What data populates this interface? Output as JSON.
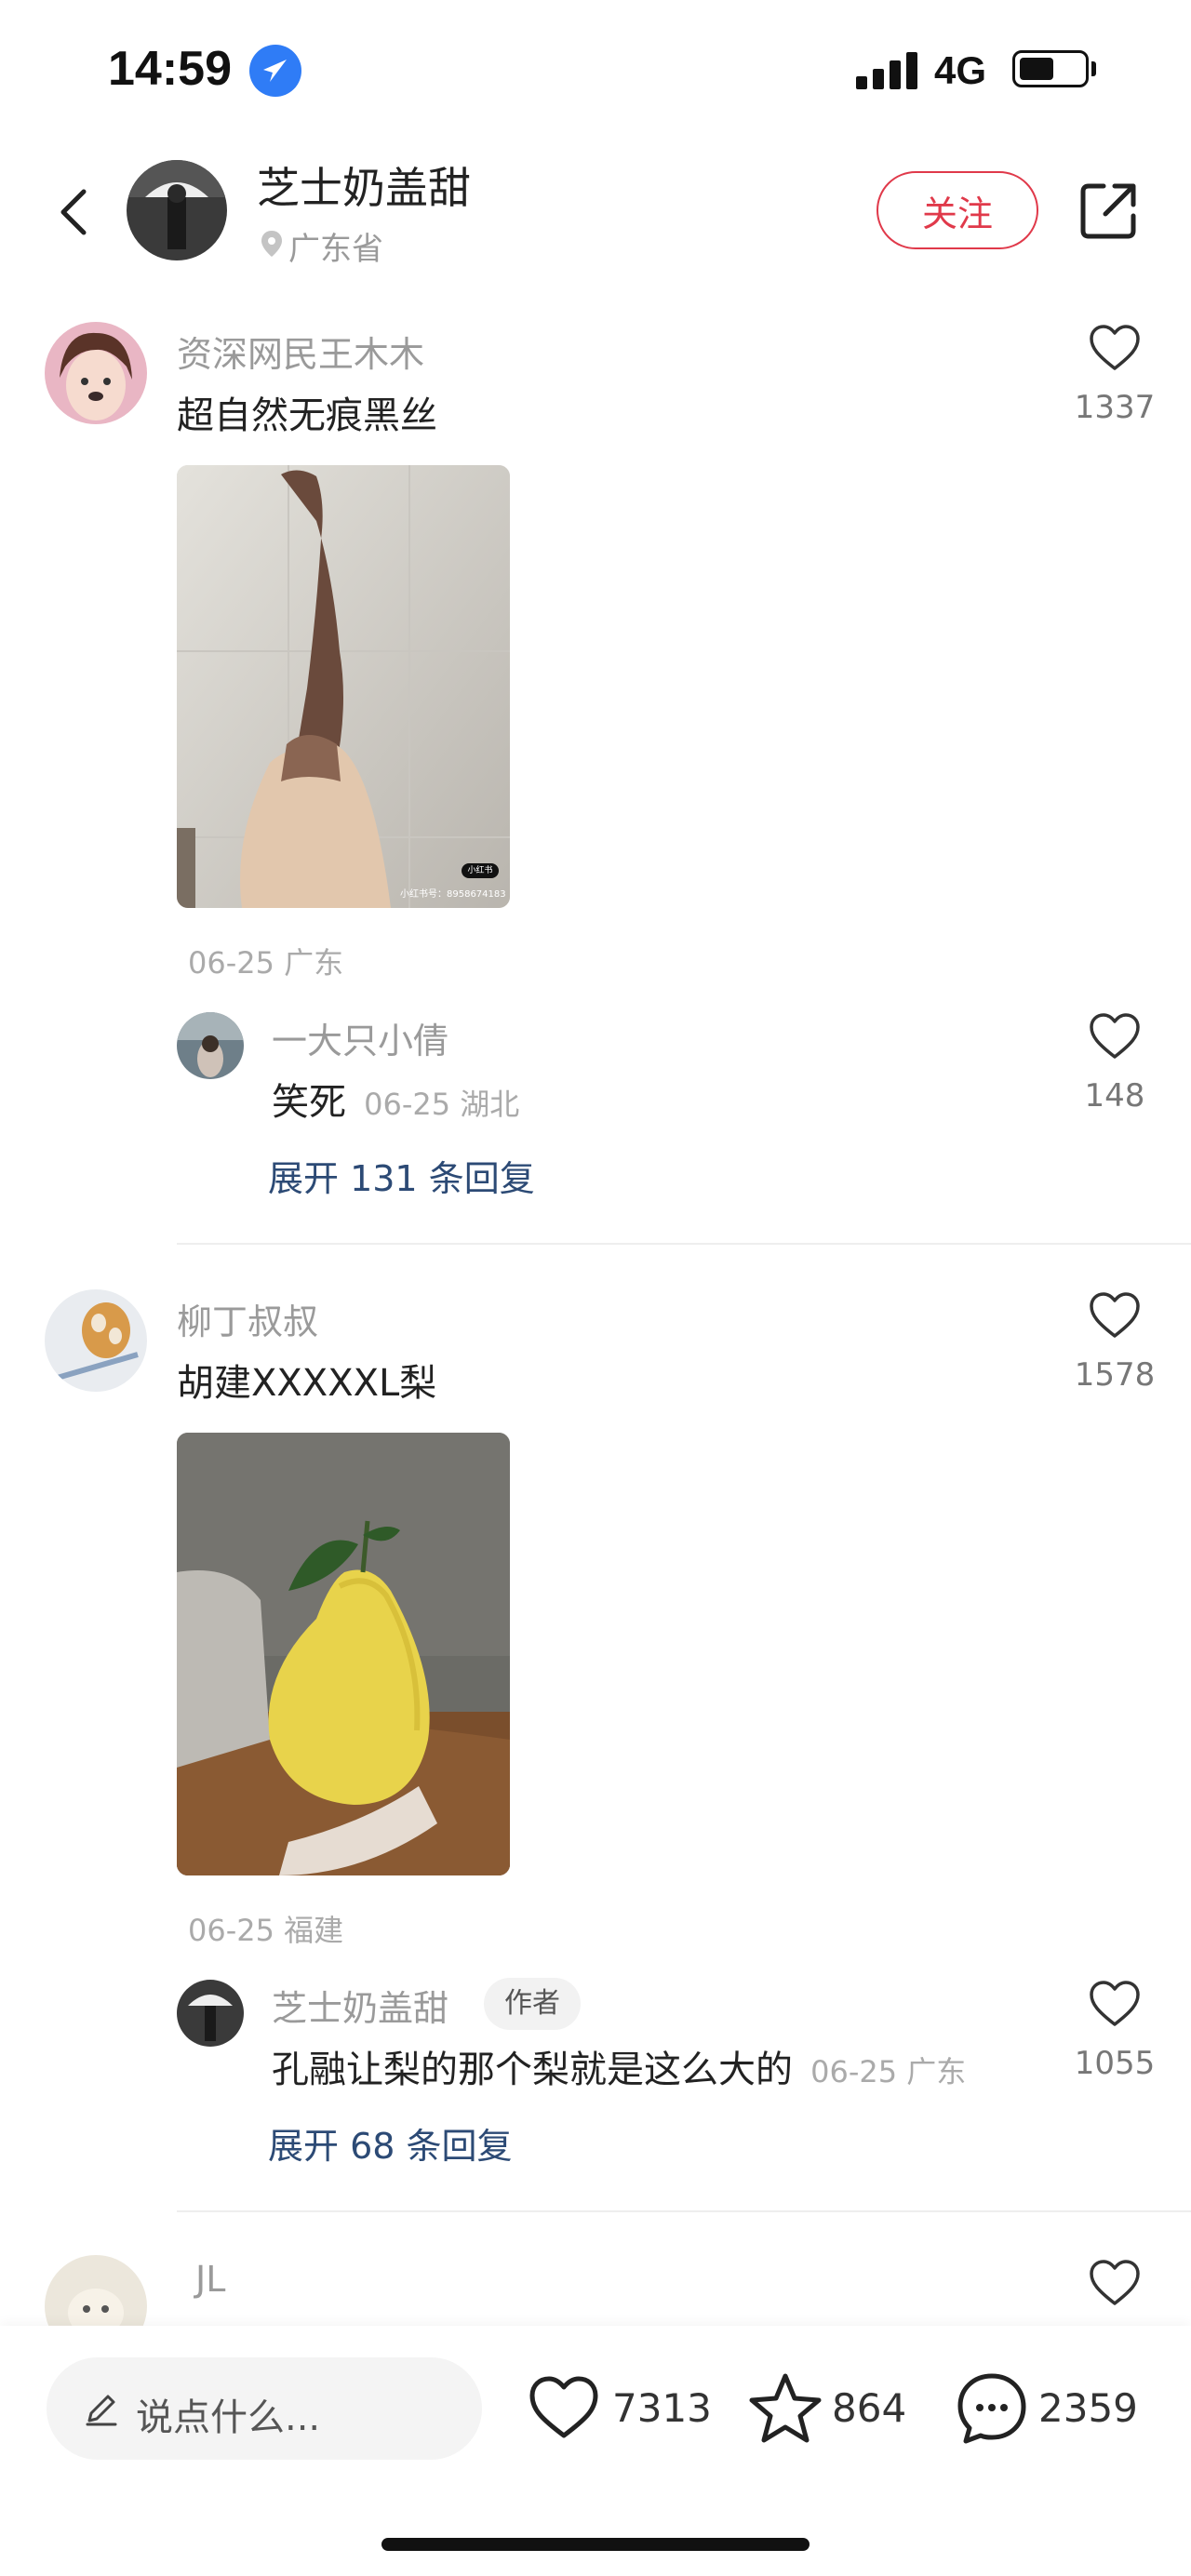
{
  "status_bar": {
    "time": "14:59",
    "network": "4G"
  },
  "header": {
    "name": "芝士奶盖甜",
    "location": "广东省",
    "follow_label": "关注"
  },
  "comments": [
    {
      "user": "资深网民王木木",
      "text": "超自然无痕黑丝",
      "likes": "1337",
      "meta": "06-25 广东",
      "image_watermark_badge": "小红书",
      "image_watermark": "小红书号：8958674183",
      "reply": {
        "user": "一大只小倩",
        "text": "笑死",
        "meta": "06-25 湖北",
        "likes": "148"
      },
      "expand_label": "展开 131 条回复"
    },
    {
      "user": "柳丁叔叔",
      "text": "胡建XXXXXL梨",
      "likes": "1578",
      "meta": "06-25 福建",
      "reply": {
        "user": "芝士奶盖甜",
        "tag": "作者",
        "text": "孔融让梨的那个梨就是这么大的",
        "meta": "06-25 广东",
        "likes": "1055"
      },
      "expand_label": "展开 68 条回复"
    },
    {
      "user": "JL"
    }
  ],
  "bottom_bar": {
    "input_placeholder": "说点什么...",
    "likes": "7313",
    "favorites": "864",
    "comments": "2359"
  },
  "colors": {
    "accent_red": "#e0394a",
    "link_blue": "#2c4a75",
    "location_blue": "#2f7cf6"
  },
  "icons": [
    "location-arrow-icon",
    "signal-icon",
    "battery-icon",
    "back-icon",
    "location-pin-icon",
    "share-icon",
    "heart-icon",
    "star-icon",
    "comment-icon",
    "pencil-icon"
  ]
}
